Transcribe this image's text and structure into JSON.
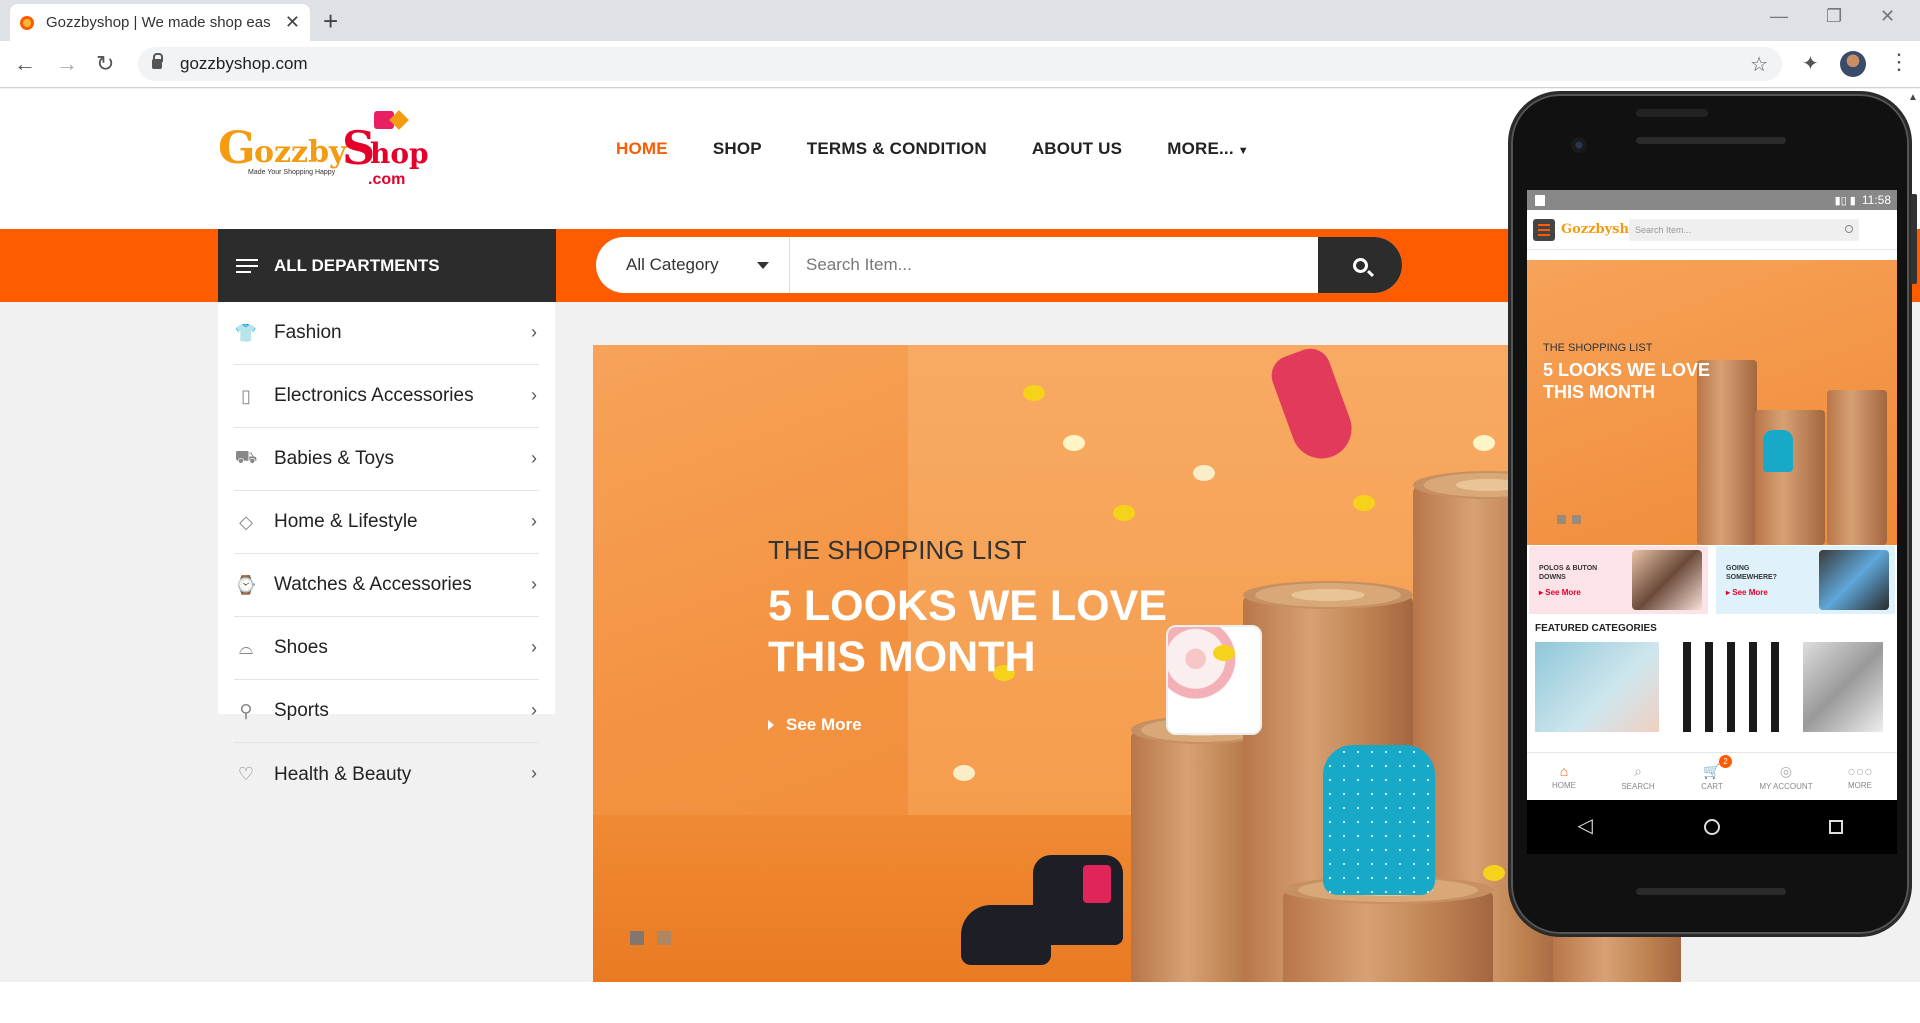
{
  "browser": {
    "tab_title": "Gozzbyshop | We made shop eas",
    "url": "gozzbyshop.com"
  },
  "site": {
    "logo": {
      "text_g": "G",
      "text_ozzby": "ozzby",
      "text_s": "S",
      "text_hop": "hop",
      "text_com": ".com",
      "tagline": "Made Your Shopping Happy"
    },
    "nav": [
      {
        "label": "HOME"
      },
      {
        "label": "SHOP"
      },
      {
        "label": "TERMS & CONDITION"
      },
      {
        "label": "ABOUT US"
      },
      {
        "label": "MORE..."
      }
    ],
    "all_departments_label": "ALL DEPARTMENTS",
    "search": {
      "category_value": "All Category",
      "placeholder": "Search Item..."
    },
    "departments": [
      {
        "label": "Fashion",
        "icon": "shirt-icon"
      },
      {
        "label": "Electronics Accessories",
        "icon": "phone-icon"
      },
      {
        "label": "Babies & Toys",
        "icon": "toy-icon"
      },
      {
        "label": "Home & Lifestyle",
        "icon": "diamond-icon"
      },
      {
        "label": "Watches & Accessories",
        "icon": "watch-icon"
      },
      {
        "label": "Shoes",
        "icon": "shoe-icon"
      },
      {
        "label": "Sports",
        "icon": "racket-icon"
      },
      {
        "label": "Health & Beauty",
        "icon": "heart-icon"
      }
    ],
    "hero": {
      "subtitle": "THE SHOPPING LIST",
      "title": "5 LOOKS WE LOVE THIS MONTH",
      "cta": "See More",
      "slide_count": 2,
      "active_slide": 1
    }
  },
  "mobile": {
    "status_time": "11:58",
    "logo": "Gozzbyshop",
    "search_placeholder": "Search Item...",
    "hero_subtitle": "THE SHOPPING LIST",
    "hero_title": "5 LOOKS WE LOVE THIS MONTH",
    "promos": [
      {
        "title": "POLOS & BUTON DOWNS",
        "link": "▸ See More"
      },
      {
        "title": "GOING SOMEWHERE?",
        "link": "▸ See More"
      }
    ],
    "featured_label": "FEATURED CATEGORIES",
    "tabs": [
      {
        "label": "HOME",
        "icon": "home-icon"
      },
      {
        "label": "SEARCH",
        "icon": "search-icon"
      },
      {
        "label": "CART",
        "icon": "cart-icon",
        "badge": "2"
      },
      {
        "label": "MY ACCOUNT",
        "icon": "account-icon"
      },
      {
        "label": "MORE",
        "icon": "more-icon"
      }
    ]
  },
  "colors": {
    "accent": "#ff5b00",
    "dark": "#2c2c2c"
  }
}
